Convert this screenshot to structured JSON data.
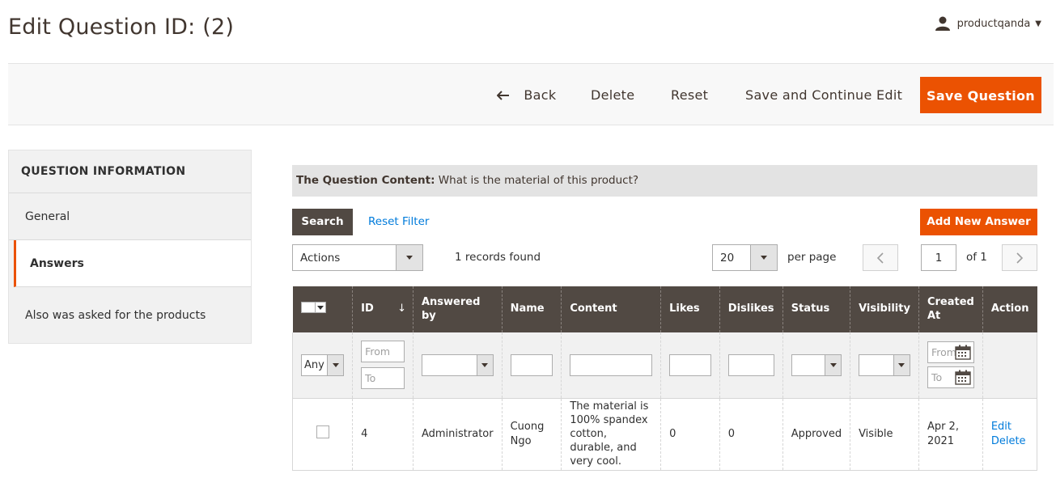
{
  "header": {
    "page_title": "Edit Question ID: (2)",
    "username": "productqanda"
  },
  "toolbar": {
    "back_label": "Back",
    "delete_label": "Delete",
    "reset_label": "Reset",
    "save_continue_label": "Save and Continue Edit",
    "save_label": "Save Question",
    "accent_color": "#eb5202"
  },
  "sidebar": {
    "title": "QUESTION INFORMATION",
    "items": [
      {
        "label": "General",
        "active": false
      },
      {
        "label": "Answers",
        "active": true
      },
      {
        "label": "Also was asked for the products",
        "active": false
      }
    ]
  },
  "question": {
    "content_label": "The Question Content:",
    "content_value": "What is the material of this product?"
  },
  "grid": {
    "search_label": "Search",
    "reset_filter_label": "Reset Filter",
    "add_label": "Add New Answer",
    "actions_select": "Actions",
    "records_found": "1 records found",
    "per_page_value": "20",
    "per_page_label": "per page",
    "current_page": "1",
    "of_pages": "of 1",
    "columns": [
      "ID",
      "Answered by",
      "Name",
      "Content",
      "Likes",
      "Dislikes",
      "Status",
      "Visibility",
      "Created At",
      "Action"
    ],
    "filters": {
      "any": "Any",
      "from_placeholder": "From",
      "to_placeholder": "To",
      "date_from_placeholder": "From",
      "date_to_placeholder": "To"
    },
    "rows": [
      {
        "id": "4",
        "answered_by": "Administrator",
        "name": "Cuong Ngo",
        "content": "The material is 100% spandex cotton, durable, and very cool.",
        "likes": "0",
        "dislikes": "0",
        "status": "Approved",
        "visibility": "Visible",
        "created_at": "Apr 2, 2021",
        "action_edit": "Edit",
        "action_delete": "Delete"
      }
    ]
  }
}
